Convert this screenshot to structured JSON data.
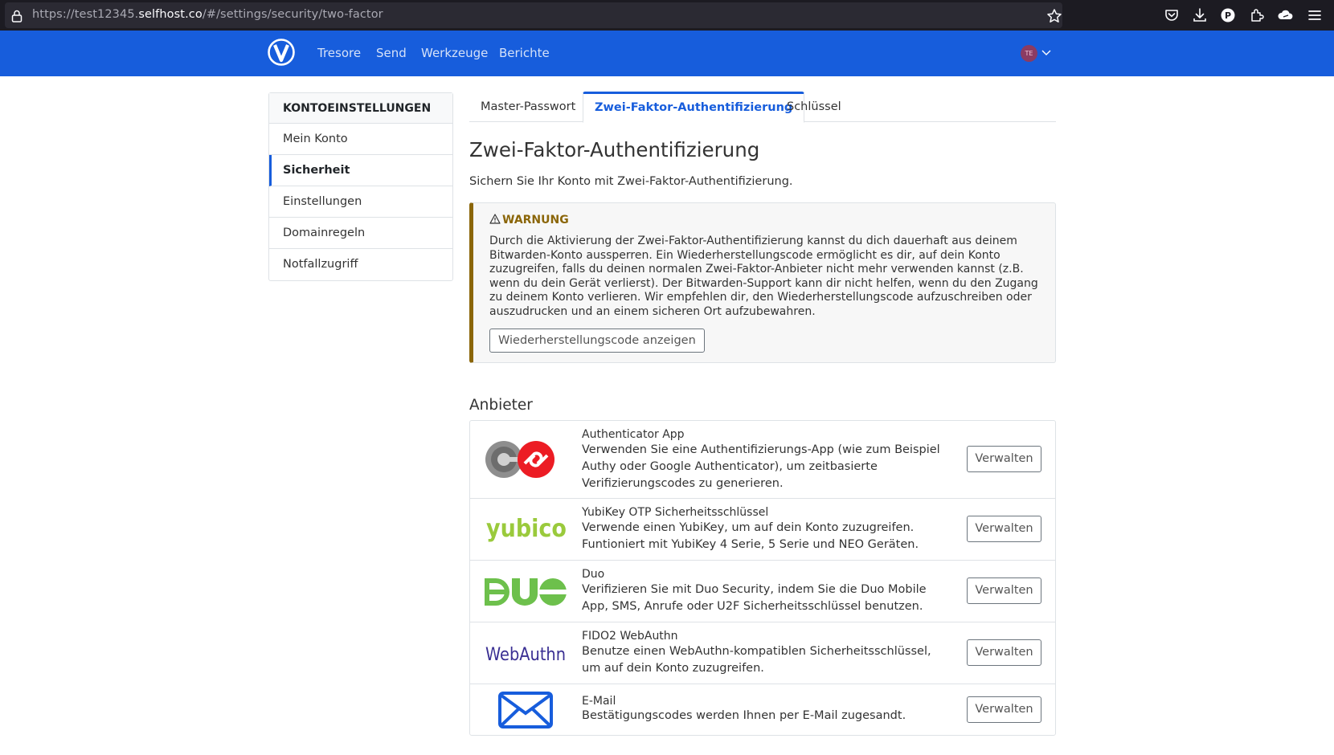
{
  "browser": {
    "url_prefix": "https://test12345.",
    "url_host": "selfhost.co",
    "url_path": "/#/settings/security/two-factor"
  },
  "navbar": {
    "links": [
      "Tresore",
      "Send",
      "Werkzeuge",
      "Berichte"
    ],
    "avatar_initials": "TE",
    "color": "#175ddc"
  },
  "sidebar": {
    "heading": "KONTOEINSTELLUNGEN",
    "items": [
      "Mein Konto",
      "Sicherheit",
      "Einstellungen",
      "Domainregeln",
      "Notfallzugriff"
    ],
    "active_index": 1
  },
  "tabs": {
    "items": [
      "Master-Passwort",
      "Zwei-Faktor-Authentifizierung",
      "Schlüssel"
    ],
    "active_index": 1
  },
  "page": {
    "title": "Zwei-Faktor-Authentifizierung",
    "description": "Sichern Sie Ihr Konto mit Zwei-Faktor-Authentifizierung."
  },
  "warning": {
    "title": "WARNUNG",
    "body": "Durch die Aktivierung der Zwei-Faktor-Authentifizierung kannst du dich dauerhaft aus deinem Bitwarden-Konto aussperren. Ein Wiederherstellungscode ermöglicht es dir, auf dein Konto zuzugreifen, falls du deinen normalen Zwei-Faktor-Anbieter nicht mehr verwenden kannst (z.B. wenn du dein Gerät verlierst). Der Bitwarden-Support kann dir nicht helfen, wenn du den Zugang zu deinem Konto verlieren. Wir empfehlen dir, den Wiederherstellungscode aufzuschreiben oder auszudrucken und an einem sicheren Ort aufzubewahren.",
    "button_label": "Wiederherstellungscode anzeigen",
    "color": "#8b6609"
  },
  "providers": {
    "heading": "Anbieter",
    "items": [
      {
        "name": "Authenticator App",
        "description": "Verwenden Sie eine Authentifizierungs-App (wie zum Beispiel Authy oder Google Authenticator), um zeitbasierte Verifizierungscodes zu generieren.",
        "button_label": "Verwalten",
        "logo": "authenticator-logo"
      },
      {
        "name": "YubiKey OTP Sicherheitsschlüssel",
        "description": "Verwende einen YubiKey, um auf dein Konto zuzugreifen. Funtioniert mit YubiKey 4 Serie, 5 Serie und NEO Geräten.",
        "button_label": "Verwalten",
        "logo": "yubico-logo",
        "logo_text": "yubico"
      },
      {
        "name": "Duo",
        "description": "Verifizieren Sie mit Duo Security, indem Sie die Duo Mobile App, SMS, Anrufe oder U2F Sicherheitsschlüssel benutzen.",
        "button_label": "Verwalten",
        "logo": "duo-logo"
      },
      {
        "name": "FIDO2 WebAuthn",
        "description": "Benutze einen WebAuthn-kompatiblen Sicherheitsschlüssel, um auf dein Konto zuzugreifen.",
        "button_label": "Verwalten",
        "logo": "webauthn-logo",
        "logo_text": "WebAuthn"
      },
      {
        "name": "E-Mail",
        "description": "Bestätigungscodes werden Ihnen per E-Mail zugesandt.",
        "button_label": "Verwalten",
        "logo": "email-icon"
      }
    ]
  }
}
